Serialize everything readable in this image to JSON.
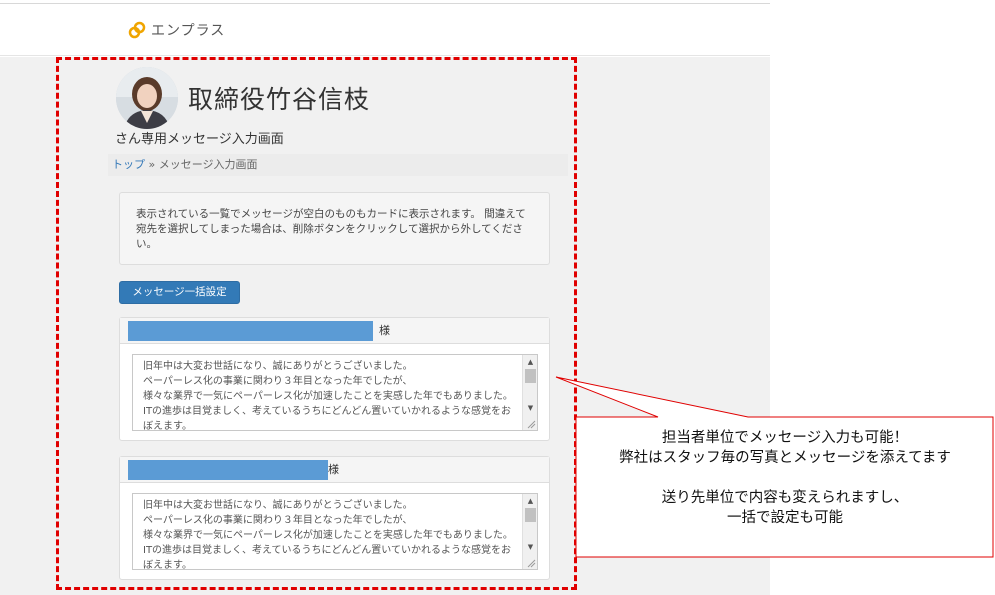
{
  "header": {
    "logo_text": "エンプラス",
    "logo_icon": "linked-rings-logo",
    "brand_color": "#f0a500"
  },
  "profile": {
    "name": "取締役竹谷信枝",
    "subtitle": "さん専用メッセージ入力画面",
    "avatar_icon": "person-photo"
  },
  "breadcrumb": {
    "home": "トップ",
    "separator": "»",
    "current": "メッセージ入力画面"
  },
  "notice": {
    "text": "表示されている一覧でメッセージが空白のものもカードに表示されます。 間違えて宛先を選択してしまった場合は、削除ボタンをクリックして選択から外してください。"
  },
  "bulk_button": {
    "label": "メッセージ一括設定"
  },
  "cards": [
    {
      "honorific": "様",
      "message": "旧年中は大変お世話になり、誠にありがとうございました。\nペーパーレス化の事業に関わり３年目となった年でしたが、\n様々な業界で一気にペーパーレス化が加速したことを実感した年でもありました。\nITの進歩は目覚ましく、考えているうちにどんどん置いていかれるような感覚をおぼえます。"
    },
    {
      "honorific": "様",
      "message": "旧年中は大変お世話になり、誠にありがとうございました。\nペーパーレス化の事業に関わり３年目となった年でしたが、\n様々な業界で一気にペーパーレス化が加速したことを実感した年でもありました。\nITの進歩は目覚ましく、考えているうちにどんどん置いていかれるような感覚をおぼえます。"
    }
  ],
  "callout": {
    "line1": "担当者単位でメッセージ入力も可能！",
    "line2": "弊社はスタッフ毎の写真とメッセージを添えてます",
    "line3": "送り先単位で内容も変えられますし、",
    "line4": "一括で設定も可能",
    "border_color": "#e00000"
  },
  "colors": {
    "highlight_frame": "#e00000",
    "button_primary": "#337ab7",
    "redaction": "#5b9bd5",
    "link": "#3579b8"
  }
}
